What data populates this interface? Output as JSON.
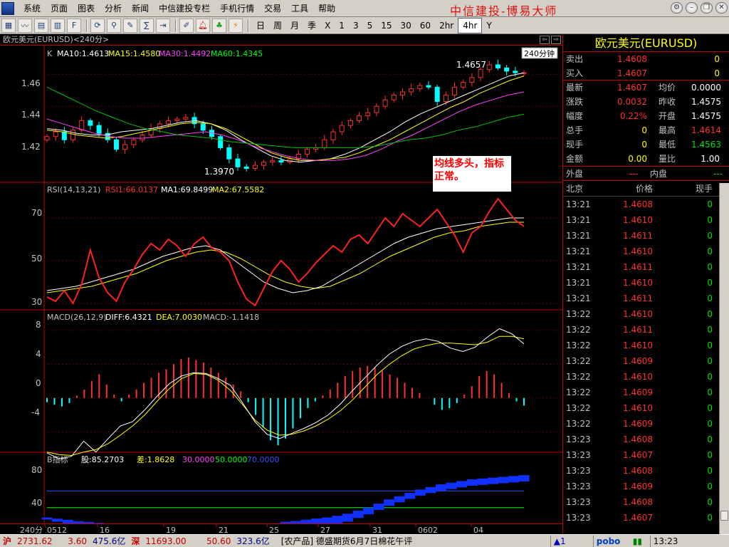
{
  "menu": {
    "items": [
      "系统",
      "页面",
      "图表",
      "分析",
      "新闻",
      "中信建投专栏",
      "手机行情",
      "交易",
      "工具",
      "帮助"
    ],
    "brand": "中信建投-博易大师"
  },
  "toolbar": {
    "icons": [
      "chart-icon",
      "line-icon",
      "grid-icon",
      "table-icon",
      "f10-icon",
      "refresh-icon",
      "zoom-in-icon",
      "draw-icon",
      "formula-icon",
      "export-icon",
      "edit-icon",
      "alarm-icon",
      "indicator-icon",
      "lightning-icon"
    ],
    "periods": [
      "日",
      "周",
      "月",
      "季",
      "X",
      "1",
      "3",
      "5",
      "15",
      "30",
      "60",
      "2hr",
      "4hr",
      "Y"
    ],
    "active_period": "4hr"
  },
  "chart": {
    "header": "欧元美元(EURUSD)<240分>",
    "kline_legend": {
      "k": "K",
      "ma10": "MA10:1.4613",
      "ma15": "MA15:1.4580",
      "ma30": "MA30:1.4492",
      "ma60": "MA60:1.4345"
    },
    "period_badge": "240分钟",
    "high_label": "1.4657",
    "low_label": "1.3970",
    "price_ticks": [
      "1.46",
      "1.44",
      "1.42"
    ],
    "note": "均线多头，指标正常。",
    "rsi_legend": {
      "name": "RSI(14,13,21)",
      "rsi1": "RSI1:66.0137",
      "ma1": "MA1:69.8499",
      "ma2": "MA2:67.5582"
    },
    "rsi_ticks": [
      "70",
      "50",
      "30"
    ],
    "macd_legend": {
      "name": "MACD(26,12,9)",
      "diff": "DIFF:6.4321",
      "dea": "DEA:7.0030",
      "macd": "MACD:-1.1418"
    },
    "macd_ticks": [
      "8",
      "4",
      "0",
      "-4"
    ],
    "b_legend": {
      "name": "B指标",
      "gu": "股:85.2703",
      "cha": "差:1.8628",
      "l30": "30.0000",
      "l50": "50.0000",
      "l70": "70.0000"
    },
    "b_ticks": [
      "80",
      "40"
    ],
    "x_period": "240分",
    "x_labels": [
      "0512",
      "16",
      "19",
      "21",
      "25",
      "27",
      "31",
      "0602",
      "04"
    ]
  },
  "chart_data": {
    "type": "candlestick",
    "title": "欧元美元(EURUSD)<240分>",
    "x_labels": [
      "0512",
      "16",
      "19",
      "21",
      "25",
      "27",
      "31",
      "0602",
      "04"
    ],
    "y_ticks": [
      1.42,
      1.44,
      1.46
    ],
    "ylim": [
      1.395,
      1.47
    ],
    "high": 1.4657,
    "low": 1.397,
    "close_series": [
      1.421,
      1.424,
      1.419,
      1.425,
      1.431,
      1.428,
      1.423,
      1.419,
      1.413,
      1.416,
      1.419,
      1.422,
      1.426,
      1.429,
      1.431,
      1.432,
      1.433,
      1.429,
      1.425,
      1.421,
      1.414,
      1.407,
      1.402,
      1.401,
      1.403,
      1.405,
      1.406,
      1.405,
      1.407,
      1.41,
      1.413,
      1.414,
      1.419,
      1.424,
      1.428,
      1.431,
      1.434,
      1.436,
      1.44,
      1.444,
      1.447,
      1.449,
      1.451,
      1.453,
      1.452,
      1.443,
      1.447,
      1.452,
      1.455,
      1.458,
      1.463,
      1.466,
      1.464,
      1.462,
      1.461,
      1.461
    ],
    "ma_series": [
      {
        "name": "MA10",
        "values": [
          1.426,
          1.425,
          1.423,
          1.422,
          1.422,
          1.424,
          1.425,
          1.426,
          1.428,
          1.43,
          1.431,
          1.429,
          1.425,
          1.419,
          1.414,
          1.409,
          1.406,
          1.405,
          1.406,
          1.407,
          1.41,
          1.414,
          1.419,
          1.424,
          1.43,
          1.435,
          1.439,
          1.443,
          1.447,
          1.451,
          1.455,
          1.459,
          1.461
        ]
      },
      {
        "name": "MA15",
        "values": [
          1.425,
          1.424,
          1.422,
          1.421,
          1.42,
          1.421,
          1.423,
          1.425,
          1.427,
          1.429,
          1.43,
          1.429,
          1.426,
          1.421,
          1.416,
          1.411,
          1.408,
          1.406,
          1.406,
          1.407,
          1.408,
          1.411,
          1.415,
          1.419,
          1.424,
          1.429,
          1.434,
          1.439,
          1.443,
          1.448,
          1.452,
          1.456,
          1.459
        ]
      },
      {
        "name": "MA30",
        "values": [
          1.432,
          1.429,
          1.426,
          1.423,
          1.421,
          1.42,
          1.42,
          1.421,
          1.422,
          1.423,
          1.424,
          1.422,
          1.419,
          1.415,
          1.412,
          1.409,
          1.407,
          1.406,
          1.406,
          1.407,
          1.409,
          1.413,
          1.418,
          1.422,
          1.427,
          1.432,
          1.437,
          1.441,
          1.444,
          1.447,
          1.449
        ]
      },
      {
        "name": "MA60",
        "values": [
          1.452,
          1.447,
          1.442,
          1.437,
          1.433,
          1.429,
          1.426,
          1.424,
          1.422,
          1.421,
          1.42,
          1.418,
          1.417,
          1.416,
          1.415,
          1.414,
          1.414,
          1.414,
          1.414,
          1.414,
          1.415,
          1.417,
          1.419,
          1.42,
          1.422,
          1.425,
          1.427,
          1.43,
          1.433,
          1.435
        ]
      }
    ],
    "rsi": {
      "ylim": [
        28,
        80
      ],
      "ticks": [
        30,
        50,
        70
      ],
      "rsi1": [
        33,
        31,
        36,
        30,
        39,
        55,
        42,
        35,
        31,
        40,
        46,
        53,
        58,
        55,
        60,
        57,
        52,
        58,
        61,
        56,
        54,
        50,
        40,
        32,
        29,
        37,
        45,
        50,
        46,
        40,
        44,
        49,
        53,
        57,
        54,
        60,
        62,
        58,
        64,
        70,
        66,
        72,
        69,
        66,
        70,
        74,
        68,
        62,
        54,
        63,
        66,
        73,
        79,
        74,
        69,
        66
      ],
      "ma1": [
        36,
        37,
        38,
        40,
        42,
        44,
        46,
        49,
        52,
        54,
        56,
        57,
        55,
        50,
        45,
        40,
        37,
        35,
        36,
        38,
        42,
        46,
        50,
        54,
        58,
        61,
        63,
        65,
        66,
        67,
        68,
        69,
        70,
        70
      ],
      "ma2": [
        35,
        36,
        37,
        38,
        40,
        42,
        44,
        47,
        50,
        52,
        54,
        55,
        54,
        51,
        47,
        43,
        40,
        38,
        37,
        38,
        41,
        44,
        48,
        52,
        55,
        58,
        61,
        63,
        64,
        66,
        67,
        68,
        68
      ]
    },
    "macd": {
      "ylim": [
        -6,
        9
      ],
      "ticks": [
        -4,
        0,
        4,
        8
      ],
      "bars": [
        -0.5,
        -0.8,
        -1,
        -0.6,
        0.3,
        1,
        2,
        2.8,
        1.6,
        0.4,
        -0.4,
        0.4,
        1,
        1.8,
        2.4,
        3,
        3.4,
        4,
        4.6,
        4.8,
        4.5,
        4.2,
        3.6,
        3,
        2.4,
        1.6,
        0.8,
        -0.5,
        -2,
        -3.5,
        -5,
        -5.6,
        -4.8,
        -3.6,
        -2.4,
        -1.2,
        -0.4,
        0.3,
        1,
        1.8,
        2.6,
        3.2,
        3.6,
        3.8,
        3.6,
        3.2,
        2.8,
        2.4,
        1.8,
        1.2,
        0.6,
        0,
        -0.8,
        -1.4,
        -1.2,
        -0.6,
        0.4,
        1.4,
        2.6,
        3.2,
        2.8,
        1.8,
        0.6,
        -0.4,
        -0.9
      ],
      "diff": [
        -6.5,
        -7.2,
        -6.9,
        -5.1,
        -6.4,
        -4.8,
        -3.3,
        -2.8,
        -1.4,
        0.2,
        1.7,
        2.6,
        3,
        2.9,
        2.3,
        1.5,
        -0.6,
        -2.8,
        -4.3,
        -4.8,
        -4.2,
        -3.6,
        -2.9,
        -2,
        -0.7,
        0.9,
        2.4,
        3.9,
        5.2,
        6.1,
        6.7,
        7,
        6.7,
        5.9,
        5.5,
        6,
        7.2,
        8.2,
        7.6,
        6.4
      ],
      "dea": [
        -6.4,
        -6.7,
        -6.8,
        -6.4,
        -6.1,
        -5.4,
        -4.4,
        -3.3,
        -2,
        -0.4,
        1.1,
        2.3,
        2.9,
        2.8,
        2.1,
        0.9,
        -0.8,
        -2.6,
        -3.8,
        -4.4,
        -4.3,
        -3.9,
        -3.3,
        -2.5,
        -1.5,
        -0.2,
        1.3,
        2.8,
        4,
        5,
        5.8,
        6.2,
        6.5,
        6.5,
        6.4,
        6.3,
        6.6,
        7.3,
        7.3,
        7
      ]
    },
    "b": {
      "ylim": [
        20,
        100
      ],
      "ticks": [
        40,
        80
      ],
      "levels": [
        30,
        50,
        70
      ],
      "gu": [
        37,
        35,
        33,
        31,
        30,
        29,
        28,
        27,
        27,
        26,
        26,
        26,
        26,
        26,
        27,
        27,
        28,
        28,
        29,
        29,
        29,
        29,
        29,
        30,
        30,
        31,
        32,
        33,
        35,
        38,
        42,
        46,
        51,
        56,
        60,
        64,
        68,
        71,
        74,
        76,
        78,
        80,
        81,
        82,
        83,
        84,
        85
      ],
      "cha": [
        0.6,
        0.9,
        1.2,
        1.4,
        1.5,
        1.4,
        1.2,
        0.9,
        0.5,
        0.2,
        -0.3,
        -0.6,
        -0.9,
        -1.1,
        -1.3,
        -1.4,
        -1.3,
        -1.1,
        -0.8,
        -0.4,
        0.1,
        0.6,
        1.1,
        1.6,
        2,
        2.3,
        2.5,
        2.6,
        2.6,
        2.4,
        2.2,
        2,
        1.9,
        1.9,
        1.8,
        1.8,
        1.8,
        1.8,
        1.9,
        1.9,
        1.9,
        1.9,
        1.9,
        1.9,
        1.9,
        1.9,
        1.9
      ]
    }
  },
  "quote": {
    "title": "欧元美元(EURUSD)",
    "sell": {
      "label": "卖出",
      "price": "1.4608",
      "vol": "0"
    },
    "buy": {
      "label": "买入",
      "price": "1.4607",
      "vol": "0"
    },
    "rows": [
      {
        "l1": "最新",
        "v1": "1.4607",
        "c1": "red",
        "l2": "均价",
        "v2": "0.0000",
        "c2": "white"
      },
      {
        "l1": "涨跌",
        "v1": "0.0032",
        "c1": "red",
        "l2": "昨收",
        "v2": "1.4575",
        "c2": "white"
      },
      {
        "l1": "幅度",
        "v1": "0.22%",
        "c1": "red",
        "l2": "开盘",
        "v2": "1.4575",
        "c2": "white"
      },
      {
        "l1": "总手",
        "v1": "0",
        "c1": "yellow",
        "l2": "最高",
        "v2": "1.4614",
        "c2": "red"
      },
      {
        "l1": "现手",
        "v1": "0",
        "c1": "yellow",
        "l2": "最低",
        "v2": "1.4563",
        "c2": "green"
      },
      {
        "l1": "金额",
        "v1": "0.00",
        "c1": "yellow",
        "l2": "量比",
        "v2": "1.00",
        "c2": "white"
      }
    ],
    "outer": {
      "label": "外盘",
      "value": "---"
    },
    "inner": {
      "label": "内盘",
      "value": "---"
    }
  },
  "ticks": {
    "headers": [
      "北京",
      "价格",
      "现手"
    ],
    "rows": [
      [
        "13:21",
        "1.4608",
        "0"
      ],
      [
        "13:21",
        "1.4610",
        "0"
      ],
      [
        "13:21",
        "1.4611",
        "0"
      ],
      [
        "13:21",
        "1.4610",
        "0"
      ],
      [
        "13:21",
        "1.4611",
        "0"
      ],
      [
        "13:21",
        "1.4610",
        "0"
      ],
      [
        "13:21",
        "1.4611",
        "0"
      ],
      [
        "13:22",
        "1.4610",
        "0"
      ],
      [
        "13:22",
        "1.4611",
        "0"
      ],
      [
        "13:22",
        "1.4610",
        "0"
      ],
      [
        "13:22",
        "1.4609",
        "0"
      ],
      [
        "13:22",
        "1.4610",
        "0"
      ],
      [
        "13:22",
        "1.4609",
        "0"
      ],
      [
        "13:22",
        "1.4610",
        "0"
      ],
      [
        "13:22",
        "1.4609",
        "0"
      ],
      [
        "13:23",
        "1.4608",
        "0"
      ],
      [
        "13:23",
        "1.4607",
        "0"
      ],
      [
        "13:23",
        "1.4608",
        "0"
      ],
      [
        "13:23",
        "1.4609",
        "0"
      ],
      [
        "13:23",
        "1.4608",
        "0"
      ],
      [
        "13:23",
        "1.4607",
        "0"
      ]
    ]
  },
  "status": {
    "sh_label": "沪",
    "sh_index": "2731.62",
    "sh_change": "3.60",
    "sh_amount": "475.6亿",
    "sz_label": "深",
    "sz_index": "11693.00",
    "sz_change": "50.60",
    "sz_amount": "323.6亿",
    "news": "[农产品] 德盛期货6月7日棉花午评",
    "alert": "▲1",
    "logo": "pobo",
    "time": "13:23"
  }
}
